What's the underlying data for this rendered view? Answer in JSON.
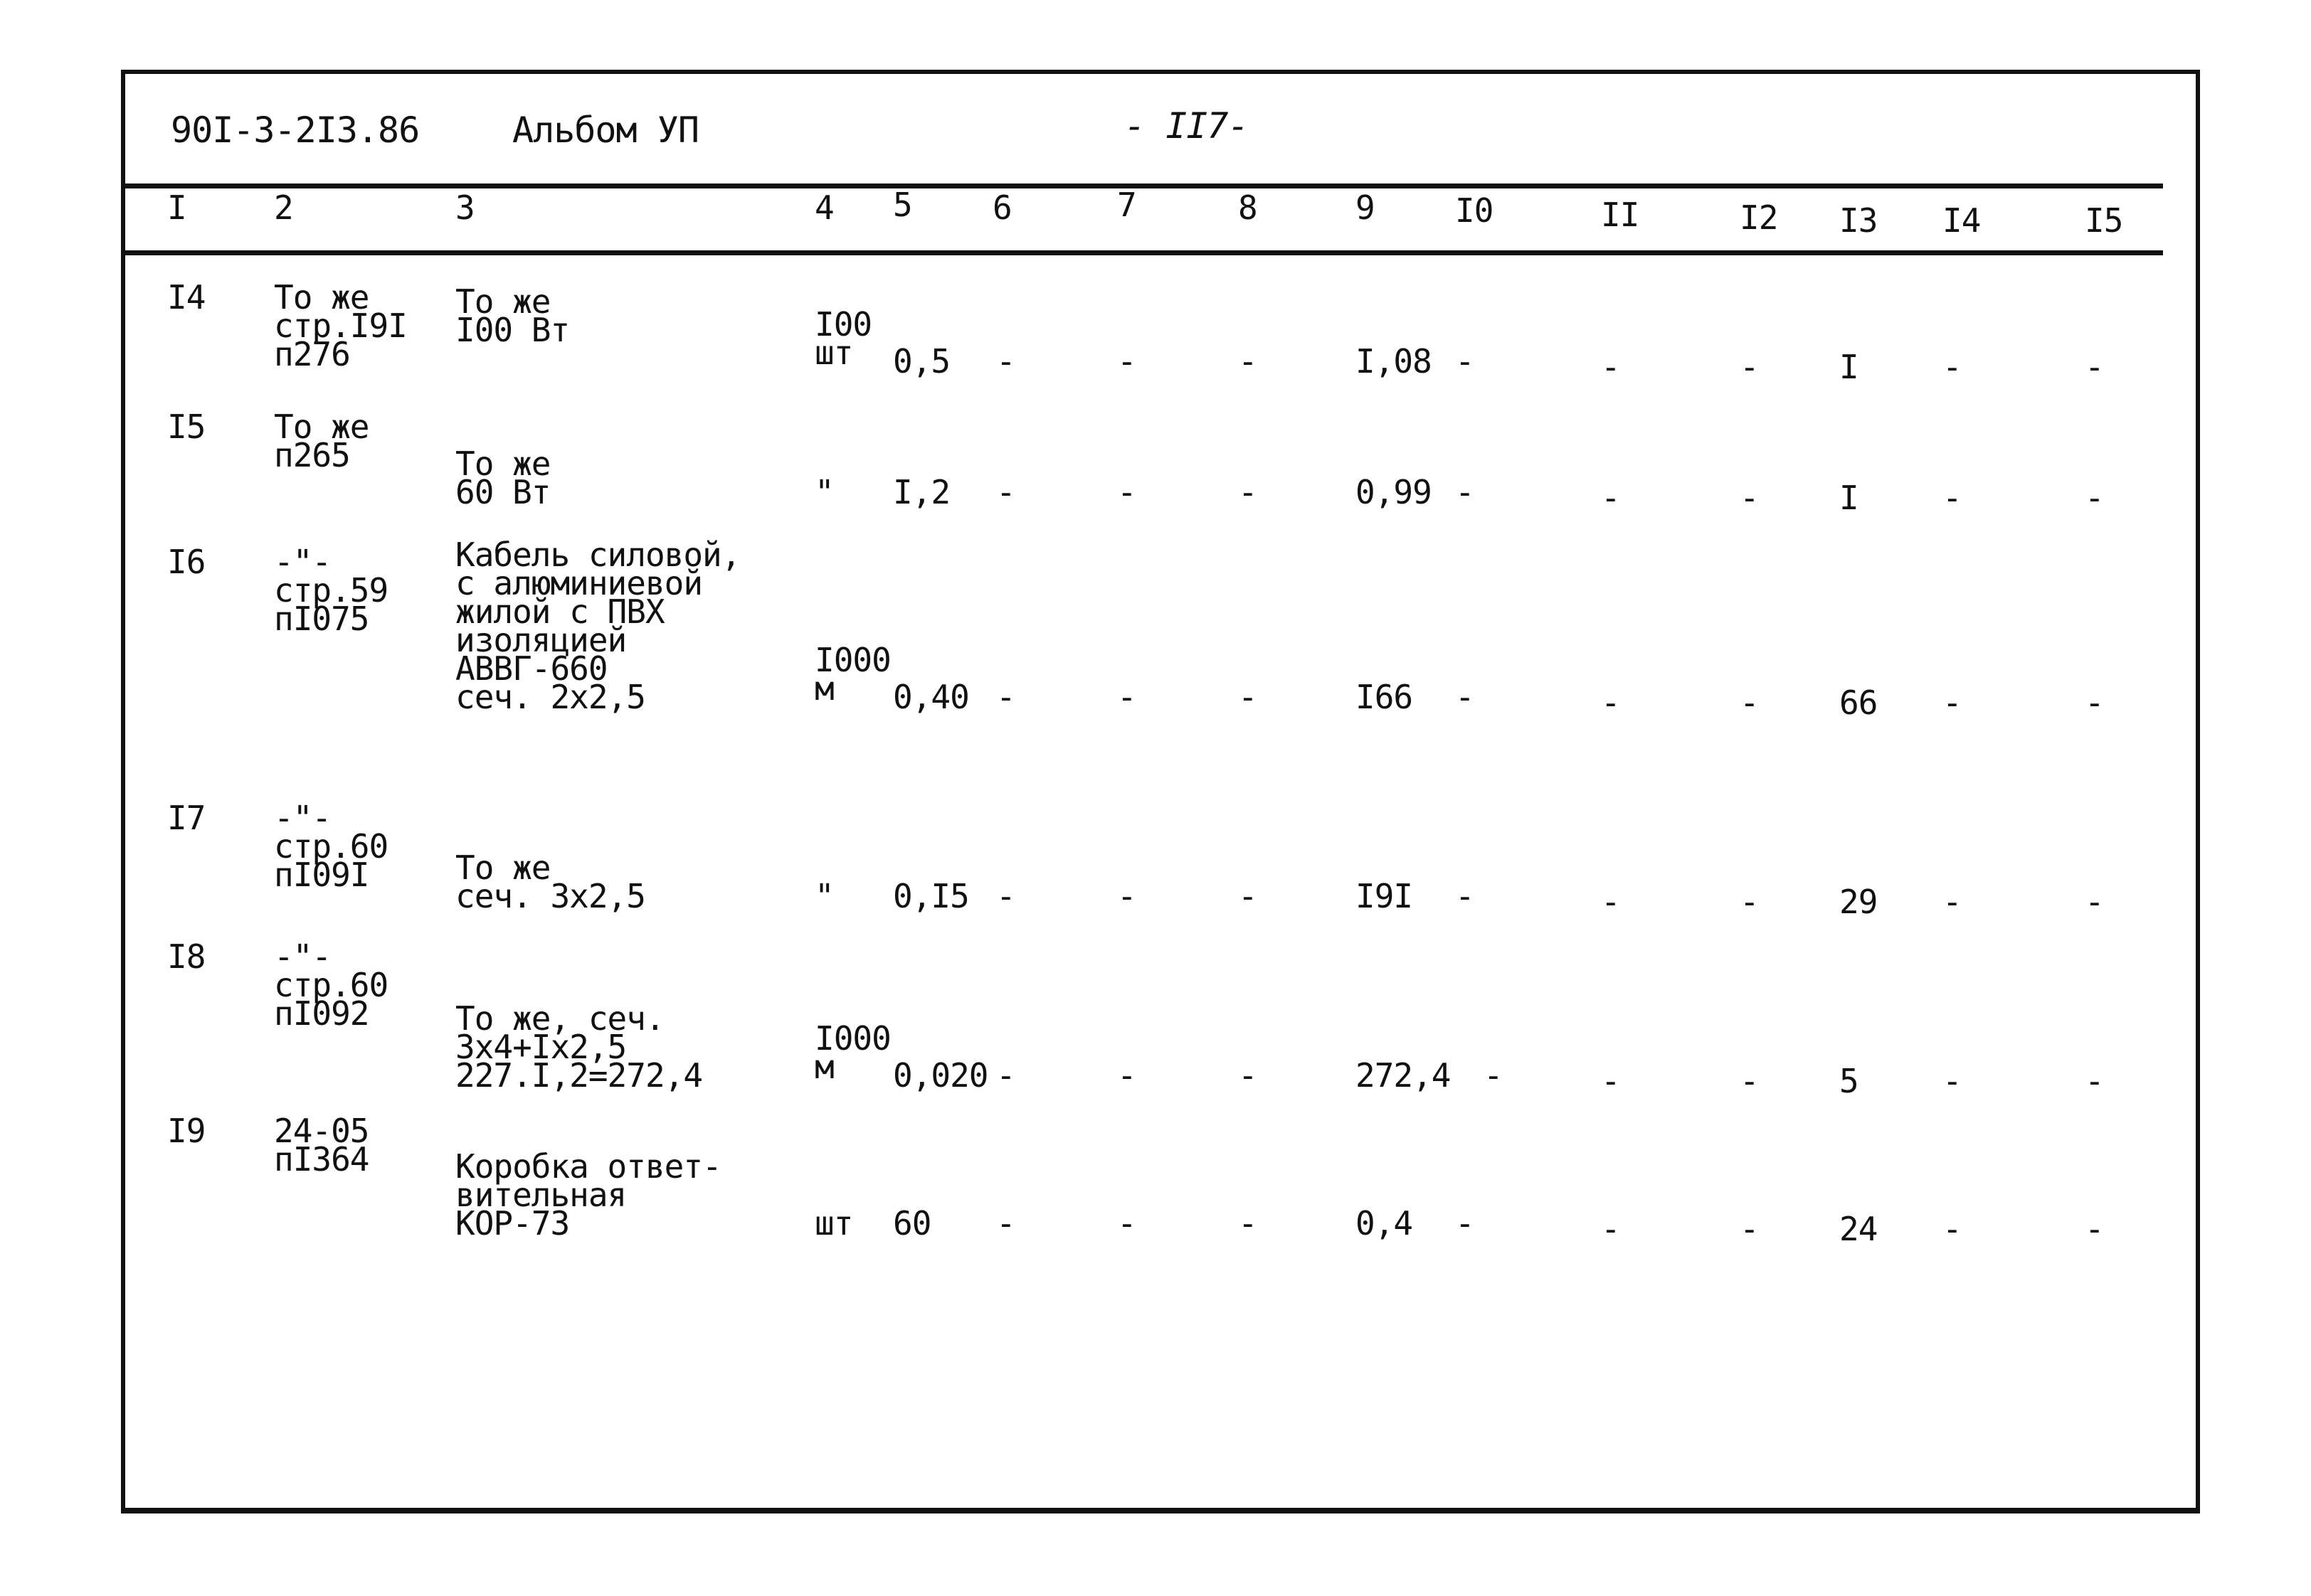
{
  "header": {
    "doc_code": "90I-3-2I3.86",
    "album": "Альбом УП",
    "page": "- II7-"
  },
  "columns": [
    "I",
    "2",
    "3",
    "4",
    "5",
    "6",
    "7",
    "8",
    "9",
    "I0",
    "II",
    "I2",
    "I3",
    "I4",
    "I5"
  ],
  "rows": [
    {
      "c1": "I4",
      "c2": "То же\nстр.I9I\nп276",
      "c3": "То же\nI00 Вт",
      "c4": "I00\nшт",
      "c5": "0,5",
      "c6": "-",
      "c7": "-",
      "c8": "-",
      "c9": "I,08",
      "c10": "-",
      "c11": "-",
      "c12": "-",
      "c13": "I",
      "c14": "-",
      "c15": "-"
    },
    {
      "c1": "I5",
      "c2": "То же\nп265",
      "c3": "То же\n60 Вт",
      "c4": "\"",
      "c5": "I,2",
      "c6": "-",
      "c7": "-",
      "c8": "-",
      "c9": "0,99",
      "c10": "-",
      "c11": "-",
      "c12": "-",
      "c13": "I",
      "c14": "-",
      "c15": "-"
    },
    {
      "c1": "I6",
      "c2": "-\"-\nстр.59\nпI075",
      "c3": "Кабель силовой,\nс алюминиевой\nжилой с ПВХ\nизоляцией\nАВВГ-660\nсеч. 2х2,5",
      "c4": "I000\nм",
      "c5": "0,40",
      "c6": "-",
      "c7": "-",
      "c8": "-",
      "c9": "I66",
      "c10": "-",
      "c11": "-",
      "c12": "-",
      "c13": "66",
      "c14": "-",
      "c15": "-"
    },
    {
      "c1": "I7",
      "c2": "-\"-\nстр.60\nпI09I",
      "c3": "То же\nсеч. 3х2,5",
      "c4": "\"",
      "c5": "0,I5",
      "c6": "-",
      "c7": "-",
      "c8": "-",
      "c9": "I9I",
      "c10": "-",
      "c11": "-",
      "c12": "-",
      "c13": "29",
      "c14": "-",
      "c15": "-"
    },
    {
      "c1": "I8",
      "c2": "-\"-\nстр.60\nпI092",
      "c3": "То же, сеч.\n3х4+Iх2,5\n227.I,2=272,4",
      "c4": "I000\nм",
      "c5": "0,020",
      "c6": "-",
      "c7": "-",
      "c8": "-",
      "c9": "272,4",
      "c10": "-",
      "c11": "-",
      "c12": "-",
      "c13": "5",
      "c14": "-",
      "c15": "-"
    },
    {
      "c1": "I9",
      "c2": "24-05\nпI364",
      "c3": "Коробка ответ-\nвительная\nКОР-73",
      "c4": "шт",
      "c5": "60",
      "c6": "-",
      "c7": "-",
      "c8": "-",
      "c9": "0,4",
      "c10": "-",
      "c11": "-",
      "c12": "-",
      "c13": "24",
      "c14": "-",
      "c15": "-"
    }
  ]
}
